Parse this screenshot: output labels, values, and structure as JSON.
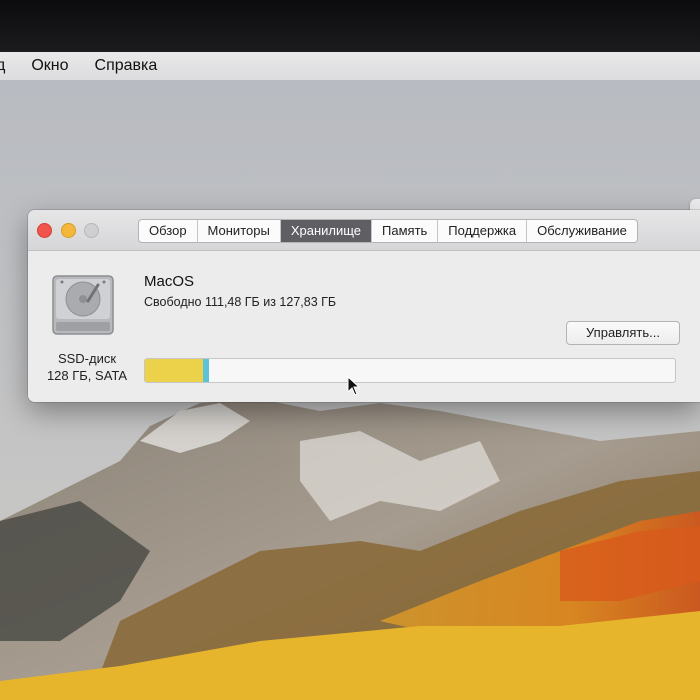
{
  "menubar": {
    "items": [
      {
        "label": "д"
      },
      {
        "label": "Окно"
      },
      {
        "label": "Справка"
      }
    ]
  },
  "window": {
    "tabs": [
      {
        "label": "Обзор",
        "active": false
      },
      {
        "label": "Мониторы",
        "active": false
      },
      {
        "label": "Хранилище",
        "active": true
      },
      {
        "label": "Память",
        "active": false
      },
      {
        "label": "Поддержка",
        "active": false
      },
      {
        "label": "Обслуживание",
        "active": false
      }
    ],
    "disk": {
      "name": "SSD-диск",
      "spec": "128 ГБ, SATA",
      "icon": "hard-drive-icon"
    },
    "volume": {
      "name": "MacOS",
      "free_text": "Свободно 111,48 ГБ из 127,83 ГБ",
      "used_fraction": 0.11,
      "other_fraction": 0.012,
      "colors": {
        "apps": "#ecd24a",
        "other": "#5cc3d6",
        "free": "#f7f7f7"
      }
    },
    "manage_button": "Управлять..."
  },
  "colors": {
    "active_tab": "#5f5f63",
    "close": "#f0544c",
    "minimize": "#f3b73b",
    "zoom": "#cfcfd1"
  }
}
